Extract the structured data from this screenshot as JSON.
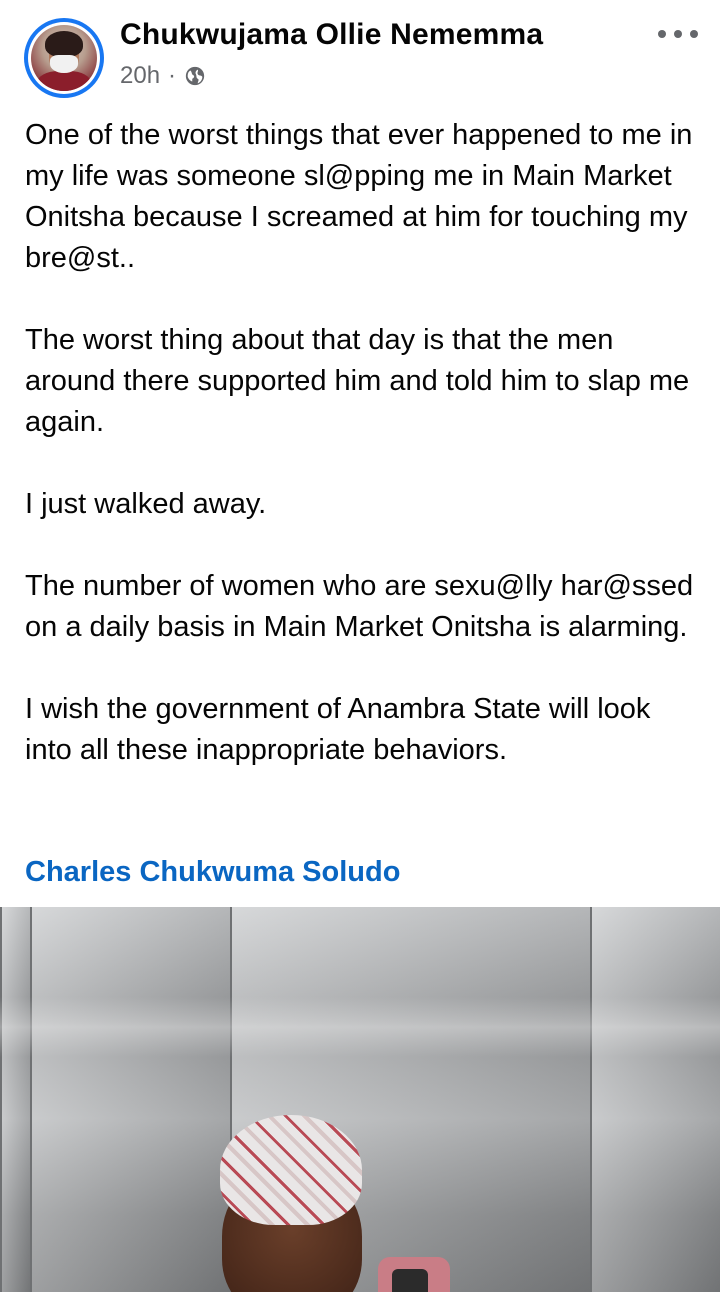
{
  "post": {
    "author": "Chukwujama Ollie Nememma",
    "time": "20h",
    "separator": "·",
    "audience_icon": "globe-icon",
    "more_icon": "more-options-icon",
    "paragraphs": [
      "One of the worst things that ever happened to me in my life was someone sl@pping me in Main Market Onitsha because I screamed at him for touching my bre@st..",
      "The worst thing about that day is that the men around there supported him and told him to slap me again.",
      "I just walked away.",
      "The number of women who are sexu@lly har@ssed on a daily basis in Main Market Onitsha is alarming.",
      "I wish the government of Anambra State will look into all these inappropriate behaviors."
    ],
    "mention": "Charles Chukwuma Soludo"
  },
  "colors": {
    "text": "#050505",
    "meta": "#65676b",
    "mention": "#0a66c2",
    "avatar_ring": "#1877f2"
  }
}
